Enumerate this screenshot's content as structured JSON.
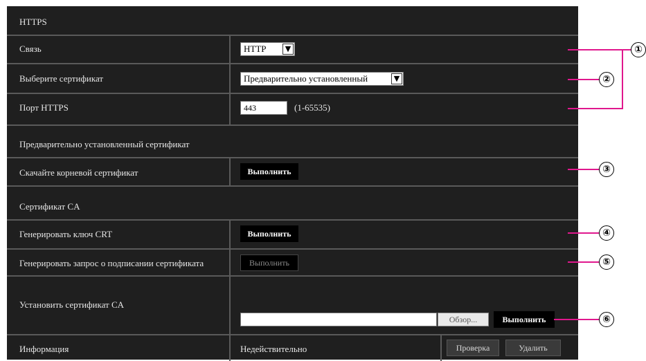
{
  "sections": {
    "https": "HTTPS",
    "preinstalled": "Предварительно установленный сертификат",
    "ca": "Сертификат CA"
  },
  "rows": {
    "connection": {
      "label": "Связь",
      "value": "HTTP"
    },
    "certificate": {
      "label": "Выберите сертификат",
      "value": "Предварительно установленный"
    },
    "port": {
      "label": "Порт HTTPS",
      "value": "443",
      "range": "(1-65535)"
    },
    "download_root": {
      "label": "Скачайте корневой сертификат",
      "button": "Выполнить"
    },
    "generate_crt": {
      "label": "Генерировать ключ CRT",
      "button": "Выполнить"
    },
    "generate_csr": {
      "label": "Генерировать запрос о подписании сертификата",
      "button": "Выполнить"
    },
    "install_ca": {
      "label": "Установить сертификат CA",
      "file_value": "",
      "browse": "Обзор...",
      "button": "Выполнить"
    },
    "info": {
      "label": "Информация",
      "value": "Недействительно",
      "check": "Проверка",
      "delete": "Удалить"
    }
  },
  "callouts": [
    "①",
    "②",
    "③",
    "④",
    "⑤",
    "⑥"
  ],
  "colors": {
    "panel": "#1f1f1f",
    "separator": "#5a5a5a",
    "callout_line": "#e0178d"
  }
}
